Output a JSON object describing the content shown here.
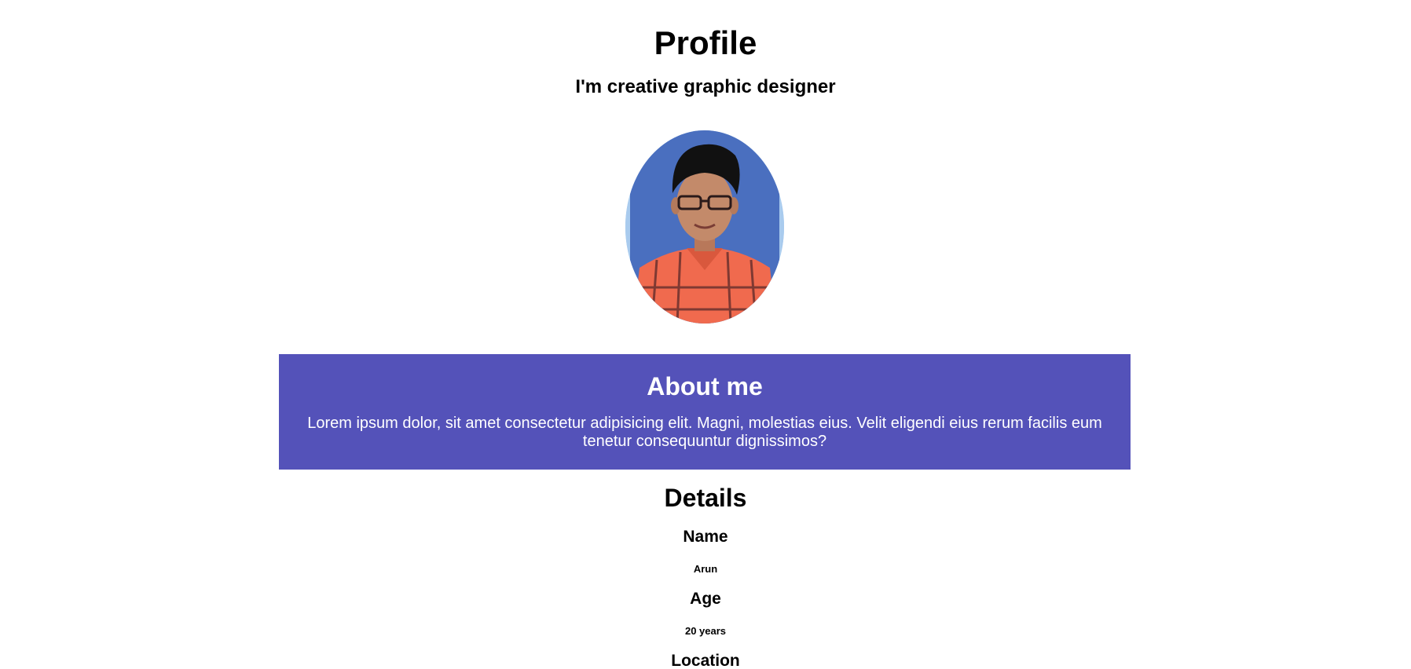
{
  "header": {
    "title": "Profile",
    "tagline": "I'm creative graphic designer"
  },
  "avatar": {
    "description_icon": "profile-photo",
    "ring_color": "#a9cbee"
  },
  "about": {
    "heading": "About me",
    "text": "Lorem ipsum dolor, sit amet consectetur adipisicing elit. Magni, molestias eius. Velit eligendi eius rerum facilis eum tenetur consequuntur dignissimos?",
    "background_color": "#5452b9"
  },
  "details": {
    "heading": "Details",
    "items": [
      {
        "label": "Name",
        "value": "Arun"
      },
      {
        "label": "Age",
        "value": "20 years"
      },
      {
        "label": "Location",
        "value": ""
      }
    ]
  }
}
